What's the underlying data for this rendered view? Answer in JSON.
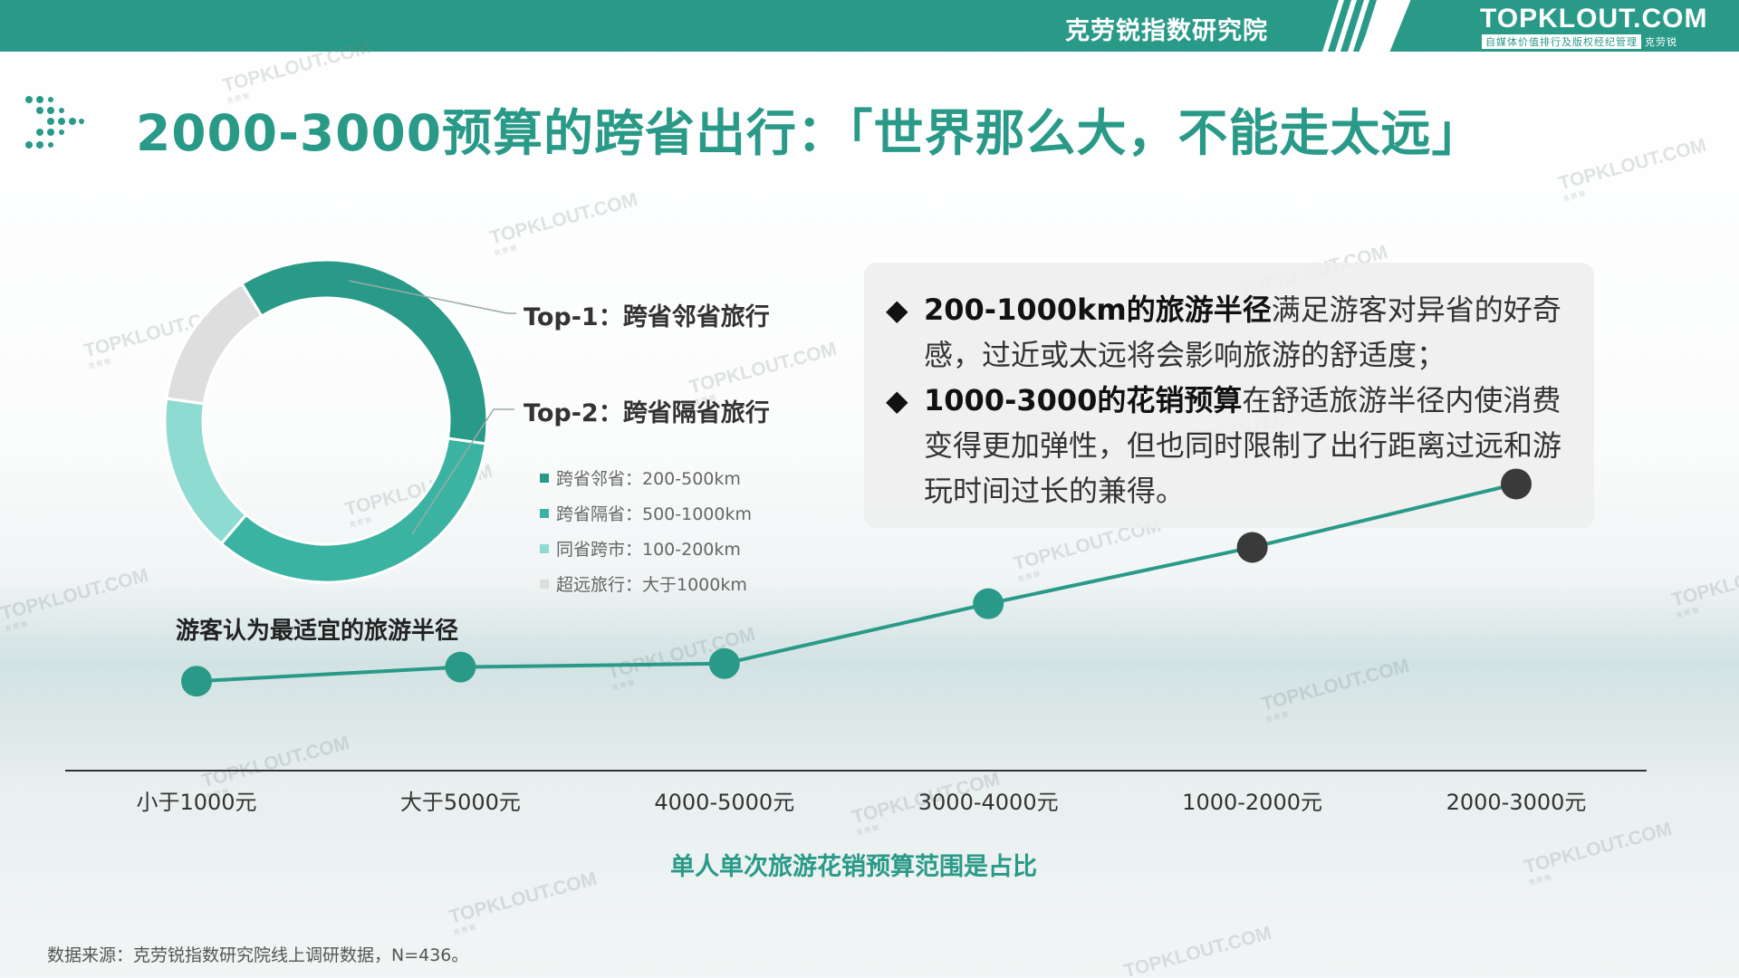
{
  "header": {
    "institute": "克劳锐指数研究院",
    "logo": "TOPKLOUT.COM",
    "logo_tagline_box": "自媒体价值排行及版权经纪管理",
    "logo_tagline_brand": "克劳锐"
  },
  "colors": {
    "brand": "#2a9a88",
    "donut": [
      "#2a9a88",
      "#3bb3a2",
      "#8edbd2",
      "#dedede"
    ],
    "line": "#2a9a88",
    "point_teal": "#2a9a88",
    "point_dark": "#3a3a3a"
  },
  "title": "2000-3000预算的跨省出行：「世界那么大，不能走太远」",
  "watermark": {
    "main": "TOPKLOUT.COM",
    "sub": "克劳锐"
  },
  "chart_data": [
    {
      "type": "pie",
      "style": "donut",
      "title": "游客认为最适宜的旅游半径",
      "slices": [
        {
          "label": "跨省邻省：200-500km",
          "value": 36,
          "color": "#2a9a88"
        },
        {
          "label": "跨省隔省：500-1000km",
          "value": 34,
          "color": "#3bb3a2"
        },
        {
          "label": "同省跨市：100-200km",
          "value": 16,
          "color": "#8edbd2"
        },
        {
          "label": "超远旅行：大于1000km",
          "value": 14,
          "color": "#dedede"
        }
      ],
      "callouts": [
        "Top-1：跨省邻省旅行",
        "Top-2：跨省隔省旅行"
      ],
      "legend": "right"
    },
    {
      "type": "line",
      "title": "单人单次旅游花销预算范围是占比",
      "categories": [
        "小于1000元",
        "大于5000元",
        "4000-5000元",
        "3000-4000元",
        "1000-2000元",
        "2000-3000元"
      ],
      "values": [
        10,
        12,
        12.5,
        21,
        29,
        38
      ],
      "highlight": [
        false,
        false,
        false,
        false,
        true,
        true
      ],
      "grid": false
    }
  ],
  "notes": [
    {
      "bold": "200-1000km的旅游半径",
      "rest": "满足游客对异省的好奇感，过近或太远将会影响旅游的舒适度；"
    },
    {
      "bold": "1000-3000的花销预算",
      "rest": "在舒适旅游半径内使消费变得更加弹性，但也同时限制了出行距离过远和游玩时间过长的兼得。"
    }
  ],
  "bullet_symbol": "◆",
  "source": "数据来源：克劳锐指数研究院线上调研数据，N=436。"
}
